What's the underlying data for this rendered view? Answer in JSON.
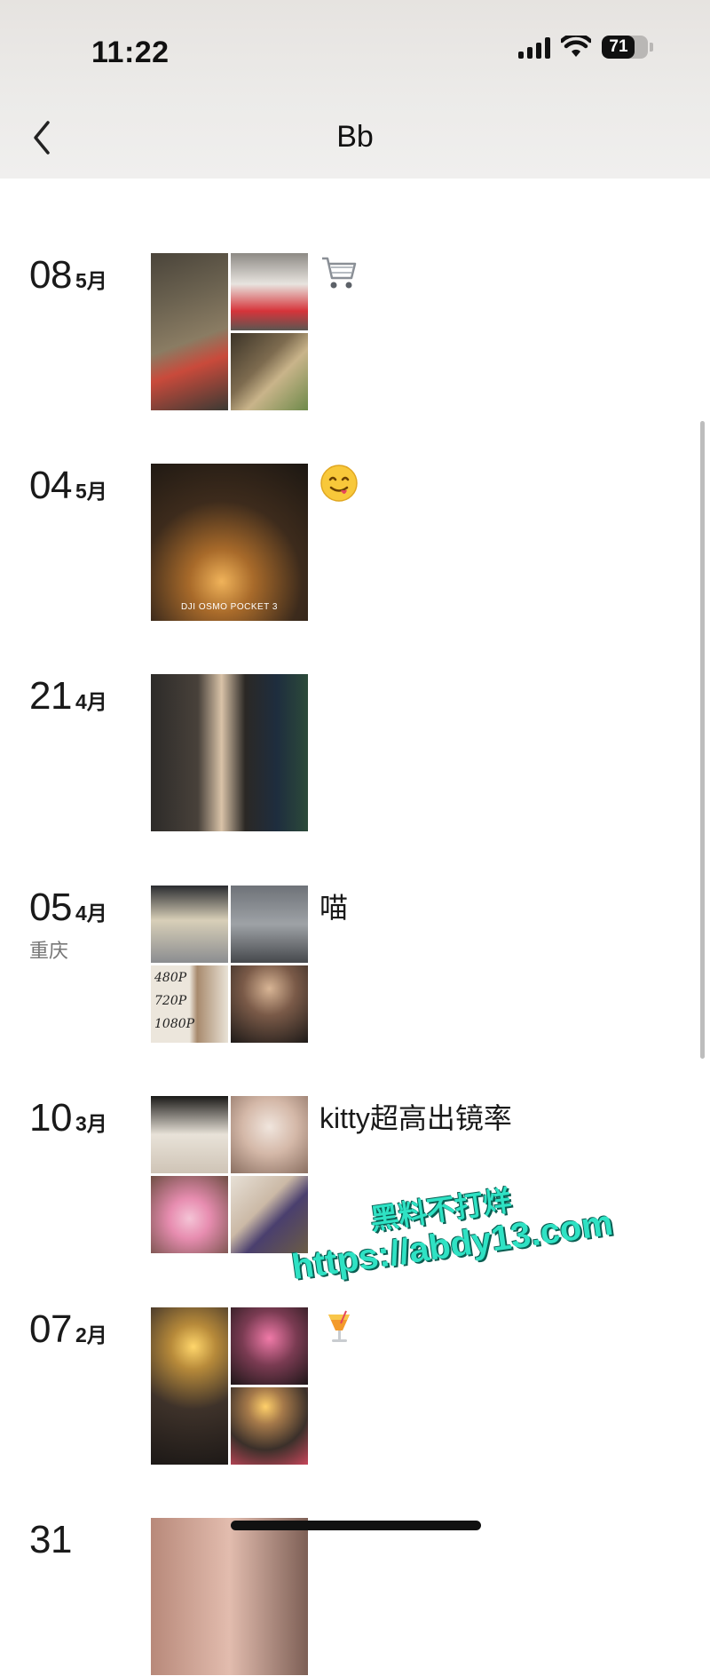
{
  "status_bar": {
    "time": "11:22",
    "battery": "71",
    "battery_level": 0.71
  },
  "header": {
    "title": "Bb",
    "back_icon": "chevron-left-icon"
  },
  "entries": [
    {
      "day": "08",
      "month": "5月",
      "location": "",
      "caption": "",
      "emoji": "shopping-cart",
      "photo_count": 3
    },
    {
      "day": "04",
      "month": "5月",
      "location": "",
      "caption": "",
      "emoji": "yum-face",
      "photo_count": 1,
      "photo_text": "DJI OSMO POCKET 3"
    },
    {
      "day": "21",
      "month": "4月",
      "location": "",
      "caption": "",
      "emoji": "",
      "photo_count": 1
    },
    {
      "day": "05",
      "month": "4月",
      "location": "重庆",
      "caption": "喵",
      "emoji": "",
      "photo_count": 4,
      "photo_text": [
        "480P",
        "720P",
        "1080P"
      ]
    },
    {
      "day": "10",
      "month": "3月",
      "location": "",
      "caption": "kitty超高出镜率",
      "emoji": "",
      "photo_count": 4
    },
    {
      "day": "07",
      "month": "2月",
      "location": "",
      "caption": "",
      "emoji": "tropical-drink",
      "photo_count": 3
    },
    {
      "day": "31",
      "month": "",
      "location": "",
      "caption": "",
      "emoji": "",
      "photo_count": 1
    }
  ],
  "watermark": {
    "line1": "黑料不打烊",
    "line2": "https://abdy13.com"
  }
}
